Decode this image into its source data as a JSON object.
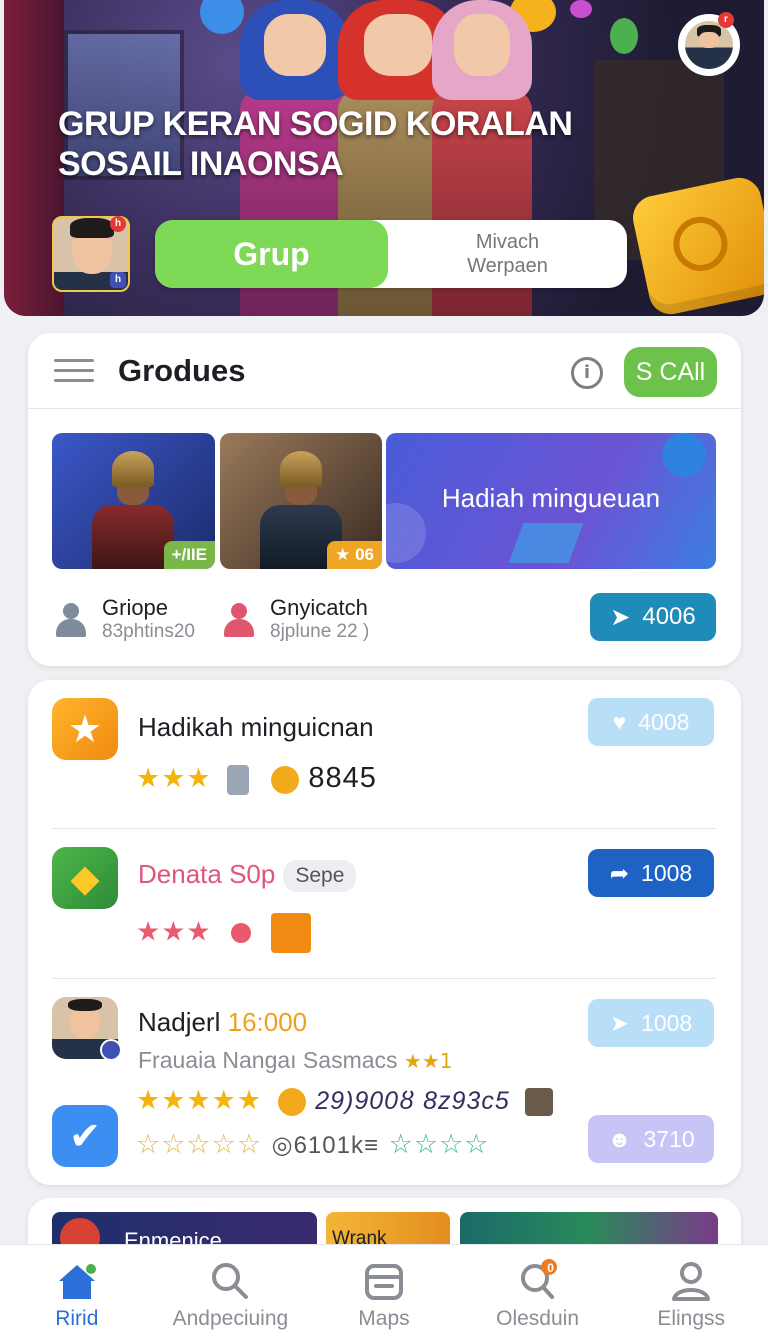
{
  "hero": {
    "title": "GRUP KERAN SOGID KORALAN SOSAIL INAONSA",
    "top_avatar_badge": "r",
    "square_avatar_badge_top": "h",
    "square_avatar_badge_bottom": "h",
    "segment_active": "Grup",
    "segment_inactive_line1": "Mivach",
    "segment_inactive_line2": "Werpaen"
  },
  "section": {
    "title": "Grodues",
    "info_icon": "i",
    "call_label": "S CAll",
    "thumb1_badge": "+/IIE",
    "thumb2_badge": "★ 06",
    "banner_text": "Hadiah minguеuan",
    "meta1_title": "Griope",
    "meta1_sub": "83phtins20",
    "meta2_title": "Gnyicatch",
    "meta2_sub": "8jplune 22 )",
    "count_label": "4006"
  },
  "list": {
    "items": [
      {
        "title": "Hadikah minguicnan",
        "stars": "★★★",
        "extra": "8845",
        "count": "4008"
      },
      {
        "title": "Denata S0p",
        "chip": "Sepe",
        "stars": "★★★",
        "count": "1008"
      },
      {
        "title_prefix": "Nadjerl",
        "title_accent": "16:000",
        "subtitle": "Frauaia Nangaı Sasmacs",
        "subtitle_stars": "★★1",
        "stars_gold": "★★★★★",
        "extra_numbers": "29)900ȣ 8z93c5",
        "stars_outline_gold": "☆☆☆☆☆",
        "extra_text2": "◎6101k≡",
        "stars_outline_teal": "☆☆☆☆",
        "count": "1008",
        "count2": "3710"
      }
    ]
  },
  "preview": {
    "strip1_text": "Enmenice",
    "strip2_text": "Wrank"
  },
  "nav": {
    "items": [
      {
        "label": "Ririd",
        "icon": "home-icon"
      },
      {
        "label": "Andpeciuing",
        "icon": "search-icon"
      },
      {
        "label": "Maps",
        "icon": "map-icon"
      },
      {
        "label": "Olesduin",
        "icon": "notification-search-icon",
        "badge": "0"
      },
      {
        "label": "Elingss",
        "icon": "profile-icon"
      }
    ]
  },
  "colors": {
    "accent_green": "#7ed957",
    "accent_blue": "#1e63c4",
    "nav_active": "#2c6fd8"
  }
}
